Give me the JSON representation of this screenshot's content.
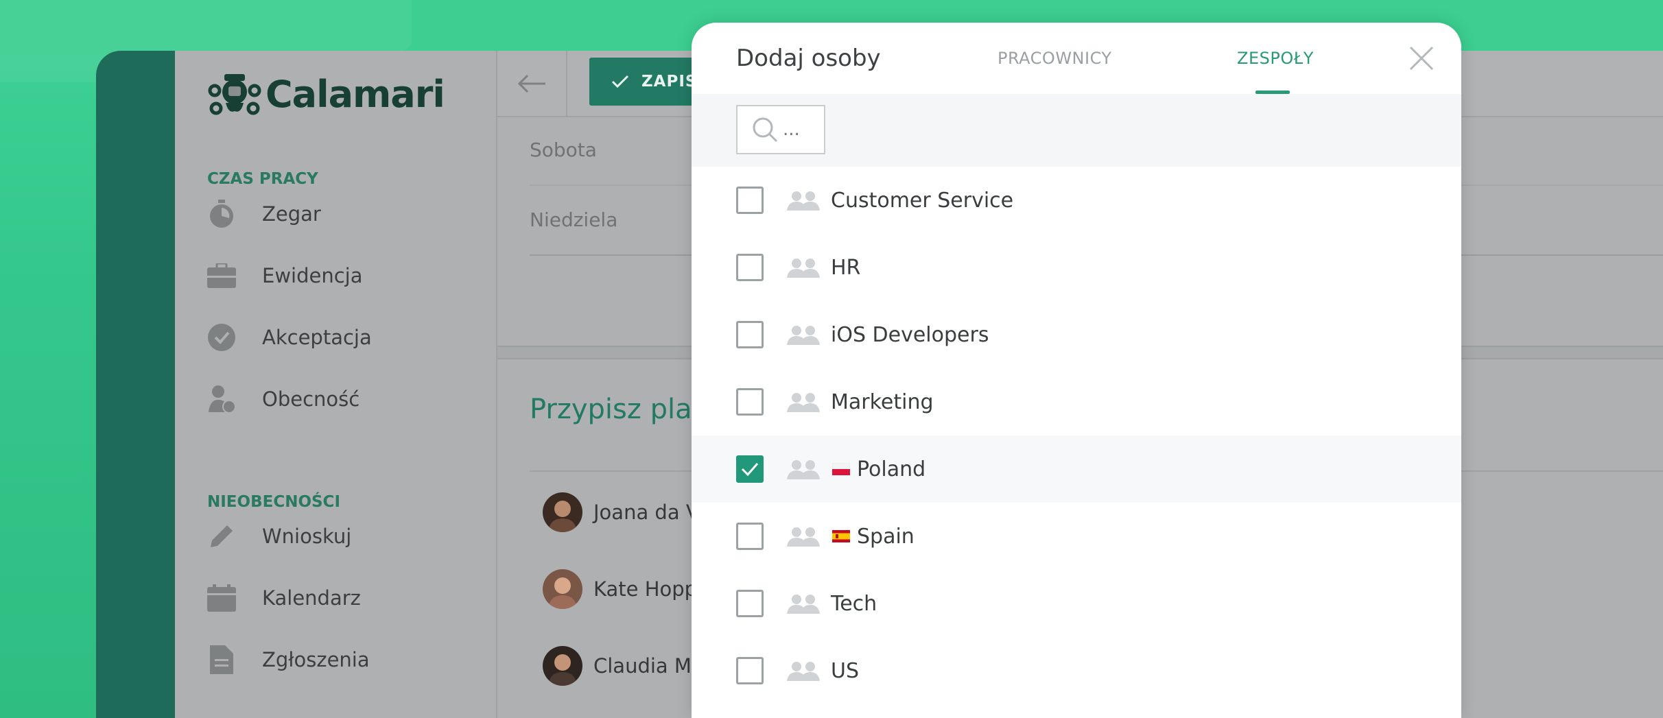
{
  "app": {
    "logo_text": "Calamari"
  },
  "sidebar": {
    "sections": [
      {
        "label": "CZAS PRACY"
      },
      {
        "label": "NIEOBECNOŚCI"
      }
    ],
    "items": [
      {
        "label": "Zegar",
        "icon": "stopwatch-icon"
      },
      {
        "label": "Ewidencja",
        "icon": "briefcase-icon"
      },
      {
        "label": "Akceptacja",
        "icon": "check-circle-icon"
      },
      {
        "label": "Obecność",
        "icon": "person-clock-icon"
      },
      {
        "label": "Wnioskuj",
        "icon": "pencil-icon"
      },
      {
        "label": "Kalendarz",
        "icon": "calendar-icon"
      },
      {
        "label": "Zgłoszenia",
        "icon": "document-icon"
      }
    ]
  },
  "main": {
    "save_label": "ZAPISZ",
    "days": [
      "Sobota",
      "Niedziela"
    ],
    "assign_title": "Przypisz plan",
    "people": [
      {
        "name": "Joana da Vi"
      },
      {
        "name": "Kate Hoppe"
      },
      {
        "name": "Claudia Mo"
      }
    ]
  },
  "modal": {
    "title": "Dodaj osoby",
    "tabs": [
      {
        "label": "PRACOWNICY",
        "active": false
      },
      {
        "label": "ZESPOŁY",
        "active": true
      }
    ],
    "search": {
      "placeholder": "...",
      "value": ""
    },
    "teams": [
      {
        "name": "Customer Service",
        "checked": false,
        "flag": ""
      },
      {
        "name": "HR",
        "checked": false,
        "flag": ""
      },
      {
        "name": "iOS Developers",
        "checked": false,
        "flag": ""
      },
      {
        "name": "Marketing",
        "checked": false,
        "flag": ""
      },
      {
        "name": "Poland",
        "checked": true,
        "flag": "pl"
      },
      {
        "name": "Spain",
        "checked": false,
        "flag": "es"
      },
      {
        "name": "Tech",
        "checked": false,
        "flag": ""
      },
      {
        "name": "US",
        "checked": false,
        "flag": ""
      }
    ]
  },
  "colors": {
    "accent": "#22987a",
    "brand_dark": "#1d6b58",
    "background": "#3ccf91"
  }
}
